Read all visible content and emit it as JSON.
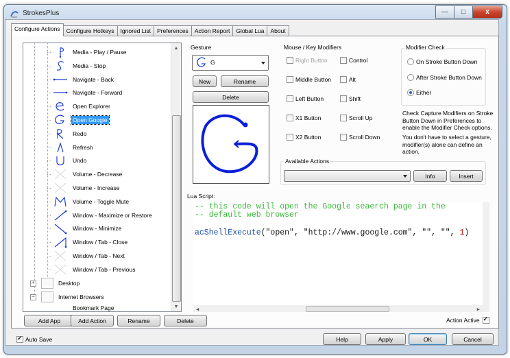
{
  "window": {
    "title": "StrokesPlus",
    "min": "—",
    "max": "□",
    "close": "x"
  },
  "tabs": [
    "Configure Actions",
    "Configure Hotkeys",
    "Ignored List",
    "Preferences",
    "Action Report",
    "Global Lua",
    "About"
  ],
  "tree": {
    "items": [
      {
        "label": "Media - Play / Pause",
        "icon": "stroke-p-icon"
      },
      {
        "label": "Media - Stop",
        "icon": "stroke-s-icon"
      },
      {
        "label": "Navigate - Back",
        "icon": "stroke-left-icon"
      },
      {
        "label": "Navigate - Forward",
        "icon": "stroke-right-icon"
      },
      {
        "label": "Open Explorer",
        "icon": "stroke-e-icon"
      },
      {
        "label": "Open Google",
        "icon": "stroke-g-icon",
        "selected": true
      },
      {
        "label": "Redo",
        "icon": "stroke-r-icon"
      },
      {
        "label": "Refresh",
        "icon": "stroke-refresh-icon"
      },
      {
        "label": "Undo",
        "icon": "stroke-u-icon"
      },
      {
        "label": "Volume - Decrease",
        "icon": "stroke-none-icon"
      },
      {
        "label": "Volume - Increase",
        "icon": "stroke-none-icon"
      },
      {
        "label": "Volume - Toggle Mute",
        "icon": "stroke-m-icon"
      },
      {
        "label": "Window - Maximize or Restore",
        "icon": "stroke-upright-icon"
      },
      {
        "label": "Window - Minimize",
        "icon": "stroke-downright-icon"
      },
      {
        "label": "Window / Tab - Close",
        "icon": "stroke-close-icon"
      },
      {
        "label": "Window / Tab - Next",
        "icon": "stroke-none-icon"
      },
      {
        "label": "Window / Tab - Previous",
        "icon": "stroke-none-icon"
      }
    ],
    "folders": [
      {
        "label": "Desktop",
        "expander": "+"
      },
      {
        "label": "Internet Browsers",
        "expander": "–"
      }
    ],
    "partial_item": "Bookmark Page"
  },
  "gesture": {
    "label": "Gesture",
    "selected": "G",
    "new": "New",
    "rename": "Rename",
    "delete": "Delete"
  },
  "modifiers": {
    "label": "Mouse / Key Modifiers",
    "left_col": [
      {
        "label": "Right Button",
        "checked": false,
        "disabled": true
      },
      {
        "label": "Middle Button",
        "checked": false
      },
      {
        "label": "Left Button",
        "checked": false
      },
      {
        "label": "X1 Button",
        "checked": false
      },
      {
        "label": "X2 Button",
        "checked": false
      }
    ],
    "right_col": [
      {
        "label": "Control",
        "checked": false
      },
      {
        "label": "Alt",
        "checked": false
      },
      {
        "label": "Shift",
        "checked": false
      },
      {
        "label": "Scroll Up",
        "checked": false
      },
      {
        "label": "Scroll Down",
        "checked": false
      }
    ]
  },
  "modifier_check": {
    "label": "Modifier Check",
    "options": [
      {
        "label": "On Stroke Button Down",
        "selected": false
      },
      {
        "label": "After Stroke Button Down",
        "selected": false
      },
      {
        "label": "Either",
        "selected": true
      }
    ],
    "note1": [
      "Check Capture Modifiers on Stroke",
      "Button Down in Preferences to",
      "enable the Modifier Check options."
    ],
    "note2": [
      "You don't have to select a gesture,",
      "modifier(s) alone can define an",
      "action."
    ]
  },
  "available_actions": {
    "label": "Available Actions",
    "value": "",
    "info": "Info",
    "insert": "Insert"
  },
  "lua": {
    "label": "Lua Script:",
    "comment1": "-- this code will open the Google seaerch page in the",
    "comment2": "-- default web browser",
    "fn": "acShellExecute",
    "args_open": "(\"open\", \"http://www.google.com\", \"\", \"\", ",
    "num": "1",
    "args_close": ")"
  },
  "bottom_buttons": {
    "add_app": "Add App",
    "add_action": "Add Action",
    "rename": "Rename",
    "delete": "Delete"
  },
  "action_active": {
    "label": "Action Active",
    "checked": true
  },
  "auto_save": {
    "label": "Auto Save",
    "checked": true
  },
  "dialog": {
    "help": "Help",
    "apply": "Apply",
    "ok": "OK",
    "cancel": "Cancel"
  }
}
